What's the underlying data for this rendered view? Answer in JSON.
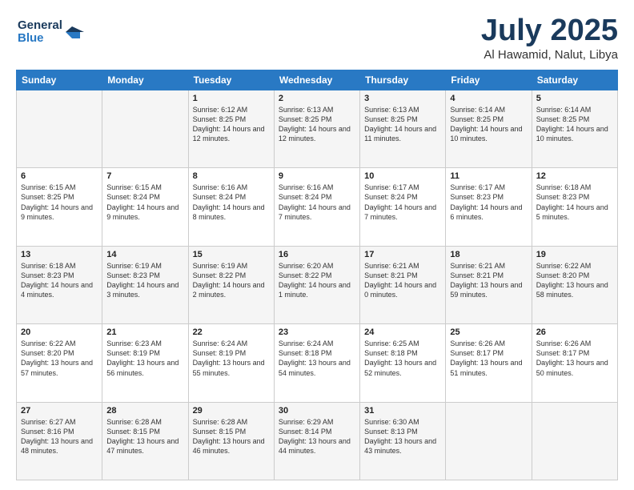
{
  "logo": {
    "line1": "General",
    "line2": "Blue"
  },
  "title": "July 2025",
  "location": "Al Hawamid, Nalut, Libya",
  "days_of_week": [
    "Sunday",
    "Monday",
    "Tuesday",
    "Wednesday",
    "Thursday",
    "Friday",
    "Saturday"
  ],
  "weeks": [
    [
      {
        "day": "",
        "content": ""
      },
      {
        "day": "",
        "content": ""
      },
      {
        "day": "1",
        "content": "Sunrise: 6:12 AM\nSunset: 8:25 PM\nDaylight: 14 hours and 12 minutes."
      },
      {
        "day": "2",
        "content": "Sunrise: 6:13 AM\nSunset: 8:25 PM\nDaylight: 14 hours and 12 minutes."
      },
      {
        "day": "3",
        "content": "Sunrise: 6:13 AM\nSunset: 8:25 PM\nDaylight: 14 hours and 11 minutes."
      },
      {
        "day": "4",
        "content": "Sunrise: 6:14 AM\nSunset: 8:25 PM\nDaylight: 14 hours and 10 minutes."
      },
      {
        "day": "5",
        "content": "Sunrise: 6:14 AM\nSunset: 8:25 PM\nDaylight: 14 hours and 10 minutes."
      }
    ],
    [
      {
        "day": "6",
        "content": "Sunrise: 6:15 AM\nSunset: 8:25 PM\nDaylight: 14 hours and 9 minutes."
      },
      {
        "day": "7",
        "content": "Sunrise: 6:15 AM\nSunset: 8:24 PM\nDaylight: 14 hours and 9 minutes."
      },
      {
        "day": "8",
        "content": "Sunrise: 6:16 AM\nSunset: 8:24 PM\nDaylight: 14 hours and 8 minutes."
      },
      {
        "day": "9",
        "content": "Sunrise: 6:16 AM\nSunset: 8:24 PM\nDaylight: 14 hours and 7 minutes."
      },
      {
        "day": "10",
        "content": "Sunrise: 6:17 AM\nSunset: 8:24 PM\nDaylight: 14 hours and 7 minutes."
      },
      {
        "day": "11",
        "content": "Sunrise: 6:17 AM\nSunset: 8:23 PM\nDaylight: 14 hours and 6 minutes."
      },
      {
        "day": "12",
        "content": "Sunrise: 6:18 AM\nSunset: 8:23 PM\nDaylight: 14 hours and 5 minutes."
      }
    ],
    [
      {
        "day": "13",
        "content": "Sunrise: 6:18 AM\nSunset: 8:23 PM\nDaylight: 14 hours and 4 minutes."
      },
      {
        "day": "14",
        "content": "Sunrise: 6:19 AM\nSunset: 8:23 PM\nDaylight: 14 hours and 3 minutes."
      },
      {
        "day": "15",
        "content": "Sunrise: 6:19 AM\nSunset: 8:22 PM\nDaylight: 14 hours and 2 minutes."
      },
      {
        "day": "16",
        "content": "Sunrise: 6:20 AM\nSunset: 8:22 PM\nDaylight: 14 hours and 1 minute."
      },
      {
        "day": "17",
        "content": "Sunrise: 6:21 AM\nSunset: 8:21 PM\nDaylight: 14 hours and 0 minutes."
      },
      {
        "day": "18",
        "content": "Sunrise: 6:21 AM\nSunset: 8:21 PM\nDaylight: 13 hours and 59 minutes."
      },
      {
        "day": "19",
        "content": "Sunrise: 6:22 AM\nSunset: 8:20 PM\nDaylight: 13 hours and 58 minutes."
      }
    ],
    [
      {
        "day": "20",
        "content": "Sunrise: 6:22 AM\nSunset: 8:20 PM\nDaylight: 13 hours and 57 minutes."
      },
      {
        "day": "21",
        "content": "Sunrise: 6:23 AM\nSunset: 8:19 PM\nDaylight: 13 hours and 56 minutes."
      },
      {
        "day": "22",
        "content": "Sunrise: 6:24 AM\nSunset: 8:19 PM\nDaylight: 13 hours and 55 minutes."
      },
      {
        "day": "23",
        "content": "Sunrise: 6:24 AM\nSunset: 8:18 PM\nDaylight: 13 hours and 54 minutes."
      },
      {
        "day": "24",
        "content": "Sunrise: 6:25 AM\nSunset: 8:18 PM\nDaylight: 13 hours and 52 minutes."
      },
      {
        "day": "25",
        "content": "Sunrise: 6:26 AM\nSunset: 8:17 PM\nDaylight: 13 hours and 51 minutes."
      },
      {
        "day": "26",
        "content": "Sunrise: 6:26 AM\nSunset: 8:17 PM\nDaylight: 13 hours and 50 minutes."
      }
    ],
    [
      {
        "day": "27",
        "content": "Sunrise: 6:27 AM\nSunset: 8:16 PM\nDaylight: 13 hours and 48 minutes."
      },
      {
        "day": "28",
        "content": "Sunrise: 6:28 AM\nSunset: 8:15 PM\nDaylight: 13 hours and 47 minutes."
      },
      {
        "day": "29",
        "content": "Sunrise: 6:28 AM\nSunset: 8:15 PM\nDaylight: 13 hours and 46 minutes."
      },
      {
        "day": "30",
        "content": "Sunrise: 6:29 AM\nSunset: 8:14 PM\nDaylight: 13 hours and 44 minutes."
      },
      {
        "day": "31",
        "content": "Sunrise: 6:30 AM\nSunset: 8:13 PM\nDaylight: 13 hours and 43 minutes."
      },
      {
        "day": "",
        "content": ""
      },
      {
        "day": "",
        "content": ""
      }
    ]
  ]
}
